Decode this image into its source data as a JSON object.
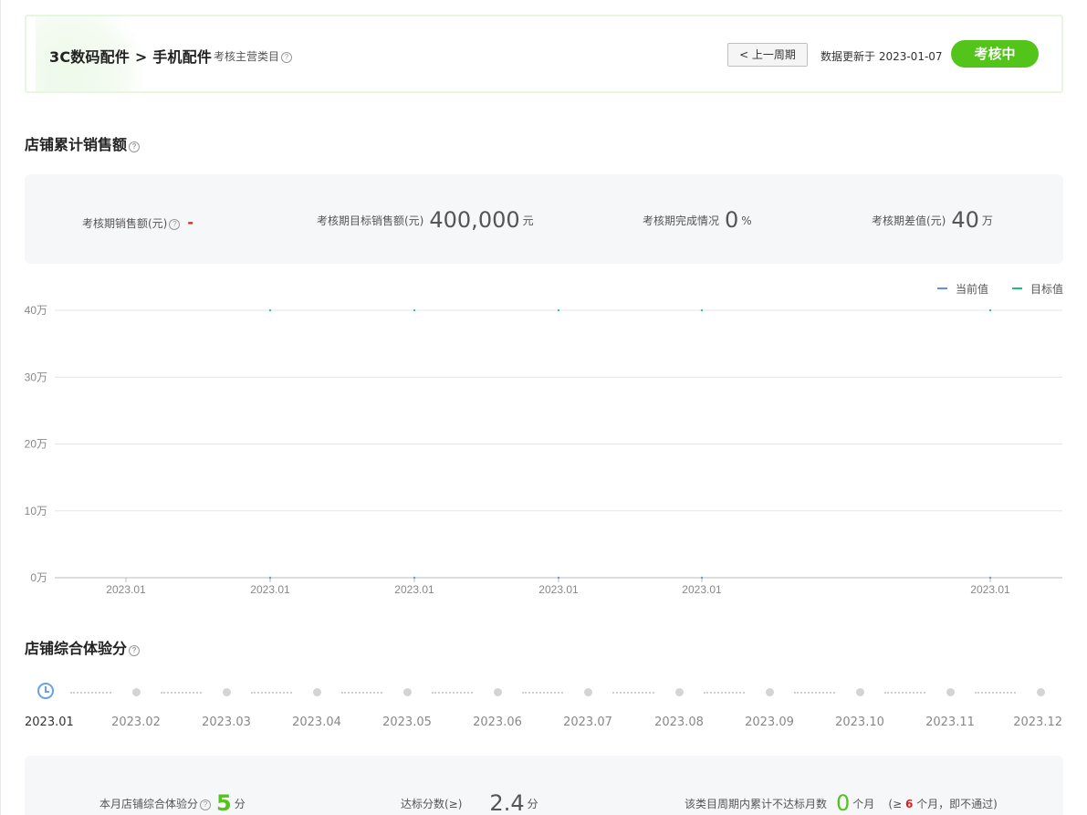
{
  "header": {
    "category_path": "3C数码配件 > 手机配件",
    "category_note": "考核主营类目",
    "prev_button": "< 上一周期",
    "update_text": "数据更新于 2023-01-07",
    "status": "考核中"
  },
  "sales_section": {
    "title": "店铺累计销售额",
    "stats": [
      {
        "label": "考核期销售额(元)",
        "value": "-",
        "unit": ""
      },
      {
        "label": "考核期目标销售额(元)",
        "value": "400,000",
        "unit": "元"
      },
      {
        "label": "考核期完成情况",
        "value": "0",
        "unit": "%"
      },
      {
        "label": "考核期差值(元)",
        "value": "40",
        "unit": "万"
      }
    ]
  },
  "chart_data": {
    "type": "line",
    "x": [
      "2023.01",
      "2023.01",
      "2023.01",
      "2023.01",
      "2023.01",
      "2023.01"
    ],
    "series": [
      {
        "name": "当前值",
        "values": [
          0,
          0,
          0,
          0,
          0,
          0
        ],
        "color": "#5b8ff9"
      },
      {
        "name": "目标值",
        "values": [
          40,
          40,
          40,
          40,
          40,
          40
        ],
        "color": "#19c37d"
      }
    ],
    "y_ticks": [
      "0万",
      "10万",
      "20万",
      "30万",
      "40万"
    ],
    "ylim": [
      0,
      40
    ],
    "grid": true,
    "legend_position": "top-right"
  },
  "experience_section": {
    "title": "店铺综合体验分",
    "timeline": [
      "2023.01",
      "2023.02",
      "2023.03",
      "2023.04",
      "2023.05",
      "2023.06",
      "2023.07",
      "2023.08",
      "2023.09",
      "2023.10",
      "2023.11",
      "2023.12"
    ],
    "stats": {
      "score_label": "本月店铺综合体验分",
      "score_value": "5",
      "score_unit": "分",
      "threshold_label": "达标分数(≥)",
      "threshold_value": "2.4",
      "threshold_unit": "分",
      "fail_label": "该类目周期内累计不达标月数",
      "fail_value": "0",
      "fail_unit": "个月",
      "fail_note_prefix": "(≥",
      "fail_note_num": "6",
      "fail_note_suffix": "个月，即不通过)"
    }
  },
  "colors": {
    "accent_green": "#52c41a",
    "current_line": "#5b8ff9",
    "target_line": "#19c37d",
    "dash_red": "#e02020"
  }
}
